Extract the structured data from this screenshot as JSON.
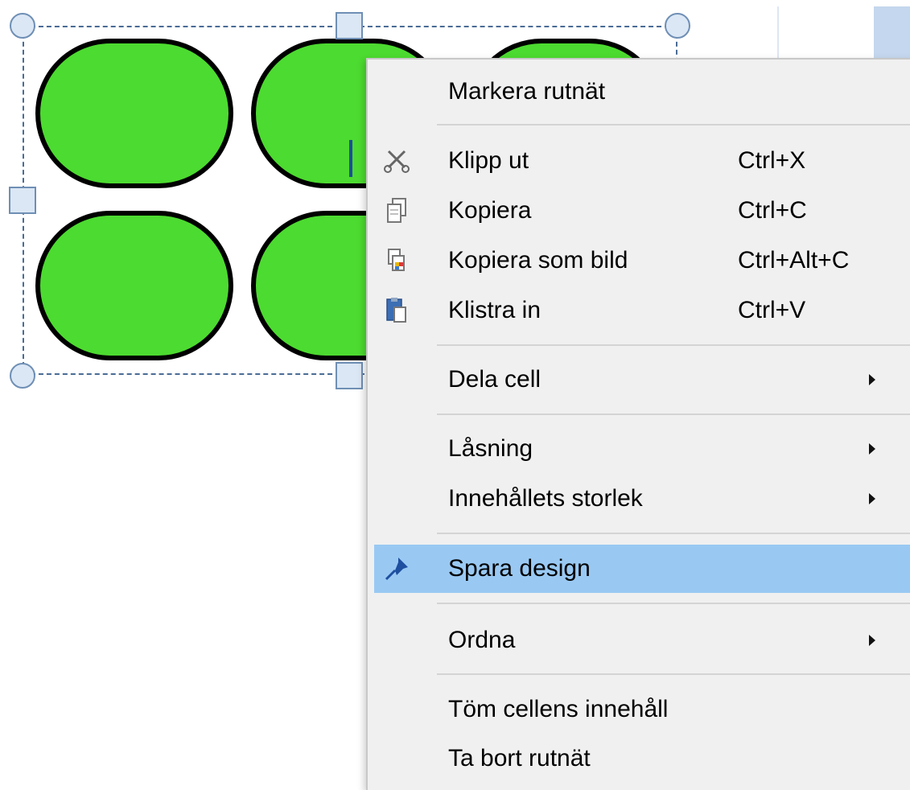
{
  "menu": {
    "items": [
      {
        "label": "Markera rutnät",
        "shortcut": "",
        "icon": "",
        "submenu": false
      },
      {
        "label": "Klipp ut",
        "shortcut": "Ctrl+X",
        "icon": "scissors-icon",
        "submenu": false
      },
      {
        "label": "Kopiera",
        "shortcut": "Ctrl+C",
        "icon": "copy-icon",
        "submenu": false
      },
      {
        "label": "Kopiera som bild",
        "shortcut": "Ctrl+Alt+C",
        "icon": "copy-as-image-icon",
        "submenu": false
      },
      {
        "label": "Klistra in",
        "shortcut": "Ctrl+V",
        "icon": "paste-icon",
        "submenu": false
      },
      {
        "label": "Dela cell",
        "shortcut": "",
        "icon": "",
        "submenu": true
      },
      {
        "label": "Låsning",
        "shortcut": "",
        "icon": "",
        "submenu": true
      },
      {
        "label": "Innehållets storlek",
        "shortcut": "",
        "icon": "",
        "submenu": true
      },
      {
        "label": "Spara design",
        "shortcut": "",
        "icon": "pin-icon",
        "submenu": false,
        "highlighted": true
      },
      {
        "label": "Ordna",
        "shortcut": "",
        "icon": "",
        "submenu": true
      },
      {
        "label": "Töm cellens innehåll",
        "shortcut": "",
        "icon": "",
        "submenu": false
      },
      {
        "label": "Ta bort rutnät",
        "shortcut": "",
        "icon": "",
        "submenu": false
      }
    ]
  },
  "colors": {
    "menu_background": "#f0f0f0",
    "highlight": "#99c9f3",
    "shape_fill": "#4cdb30",
    "selection_border": "#4a6c95"
  }
}
